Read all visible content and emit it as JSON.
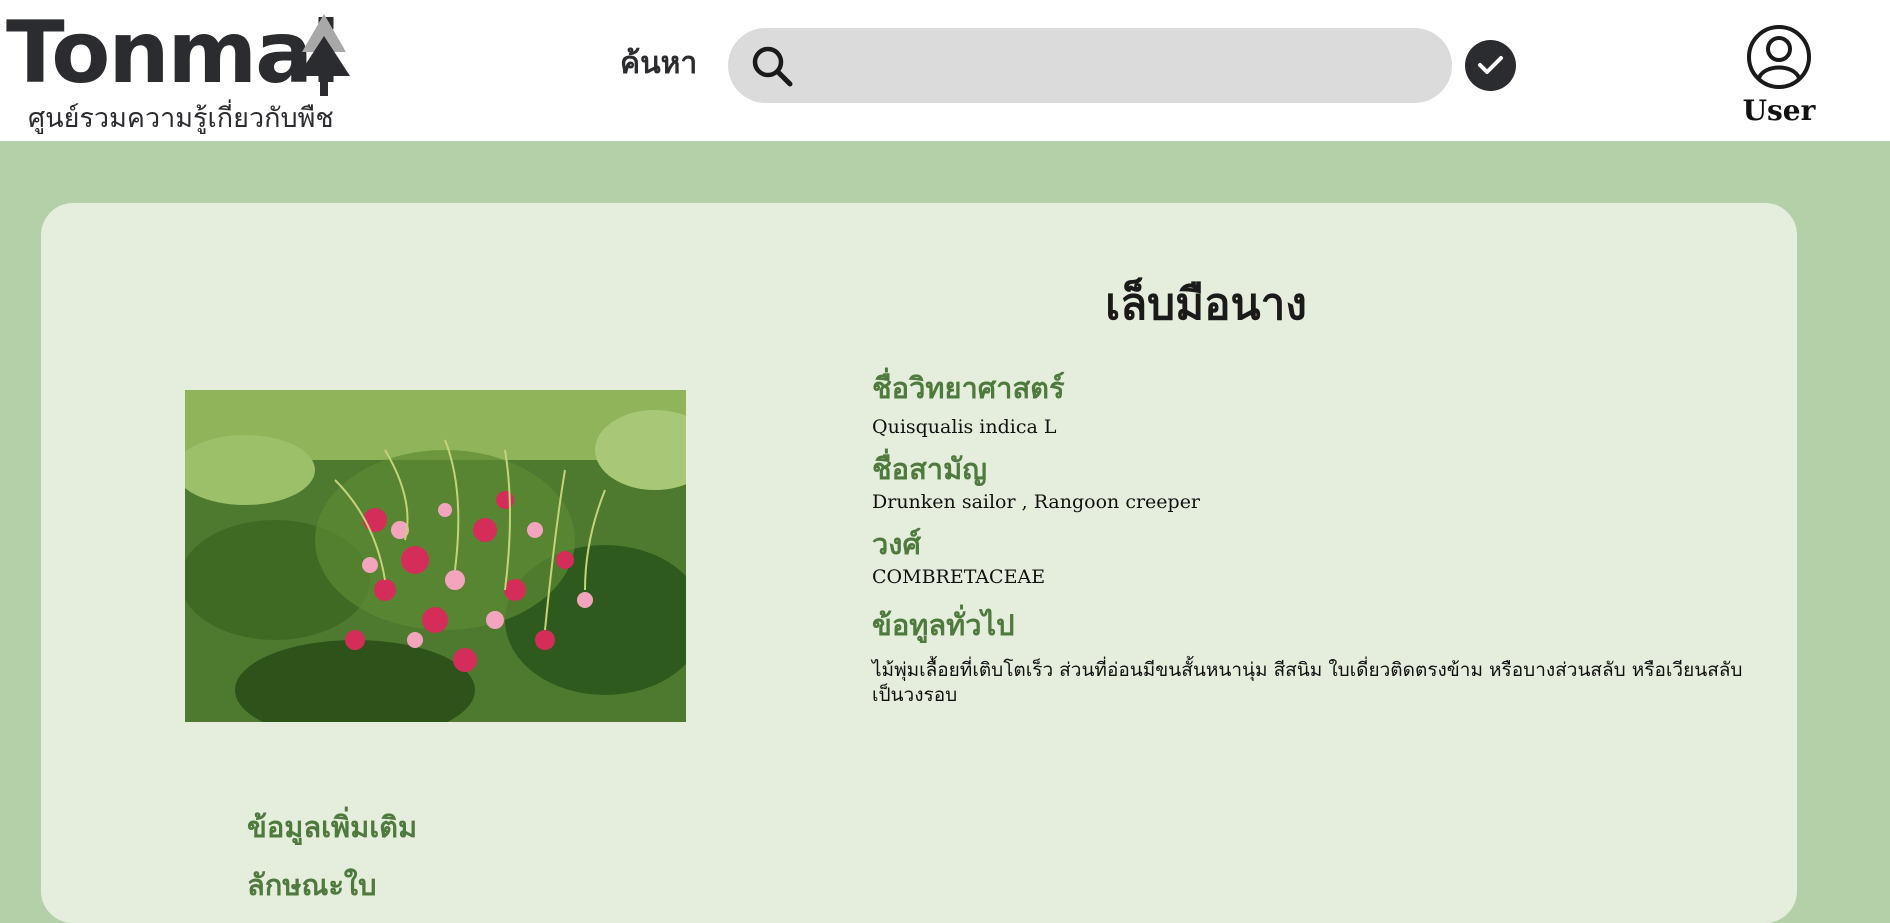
{
  "header": {
    "logo_word": "Tonmai",
    "logo_tagline": "ศูนย์รวมความรู้เกี่ยวกับพืช",
    "search_label": "ค้นหา",
    "search_value": "",
    "user_label": "User"
  },
  "plant": {
    "name": "เล็บมือนาง",
    "scientific_label": "ชื่อวิทยาศาสตร์",
    "scientific_name": "Quisqualis indica L",
    "common_label": "ชื่อสามัญ",
    "common_name": "Drunken sailor , Rangoon creeper",
    "family_label": "วงศ์",
    "family": "COMBRETACEAE",
    "general_label": "ข้อทูลทั่วไป",
    "general_text": "ไม้พุ่มเลื้อยที่เติบโตเร็ว ส่วนที่อ่อนมีขนสั้นหนานุ่ม สีสนิม ใบเดี่ยวติดตรงข้าม หรือบางส่วนสลับ หรือเวียนสลับเป็นวงรอบ"
  },
  "more": {
    "more_label": "ข้อมูลเพิ่มเติม",
    "leaf_label": "ลักษณะใบ"
  },
  "colors": {
    "page_bg": "#b4d0a8",
    "card_bg": "#e5eedc",
    "label_green": "#4f7a3d",
    "dark": "#2b2c30"
  },
  "icons": [
    "tree-logo-icon",
    "search-icon",
    "check-icon",
    "user-icon"
  ]
}
